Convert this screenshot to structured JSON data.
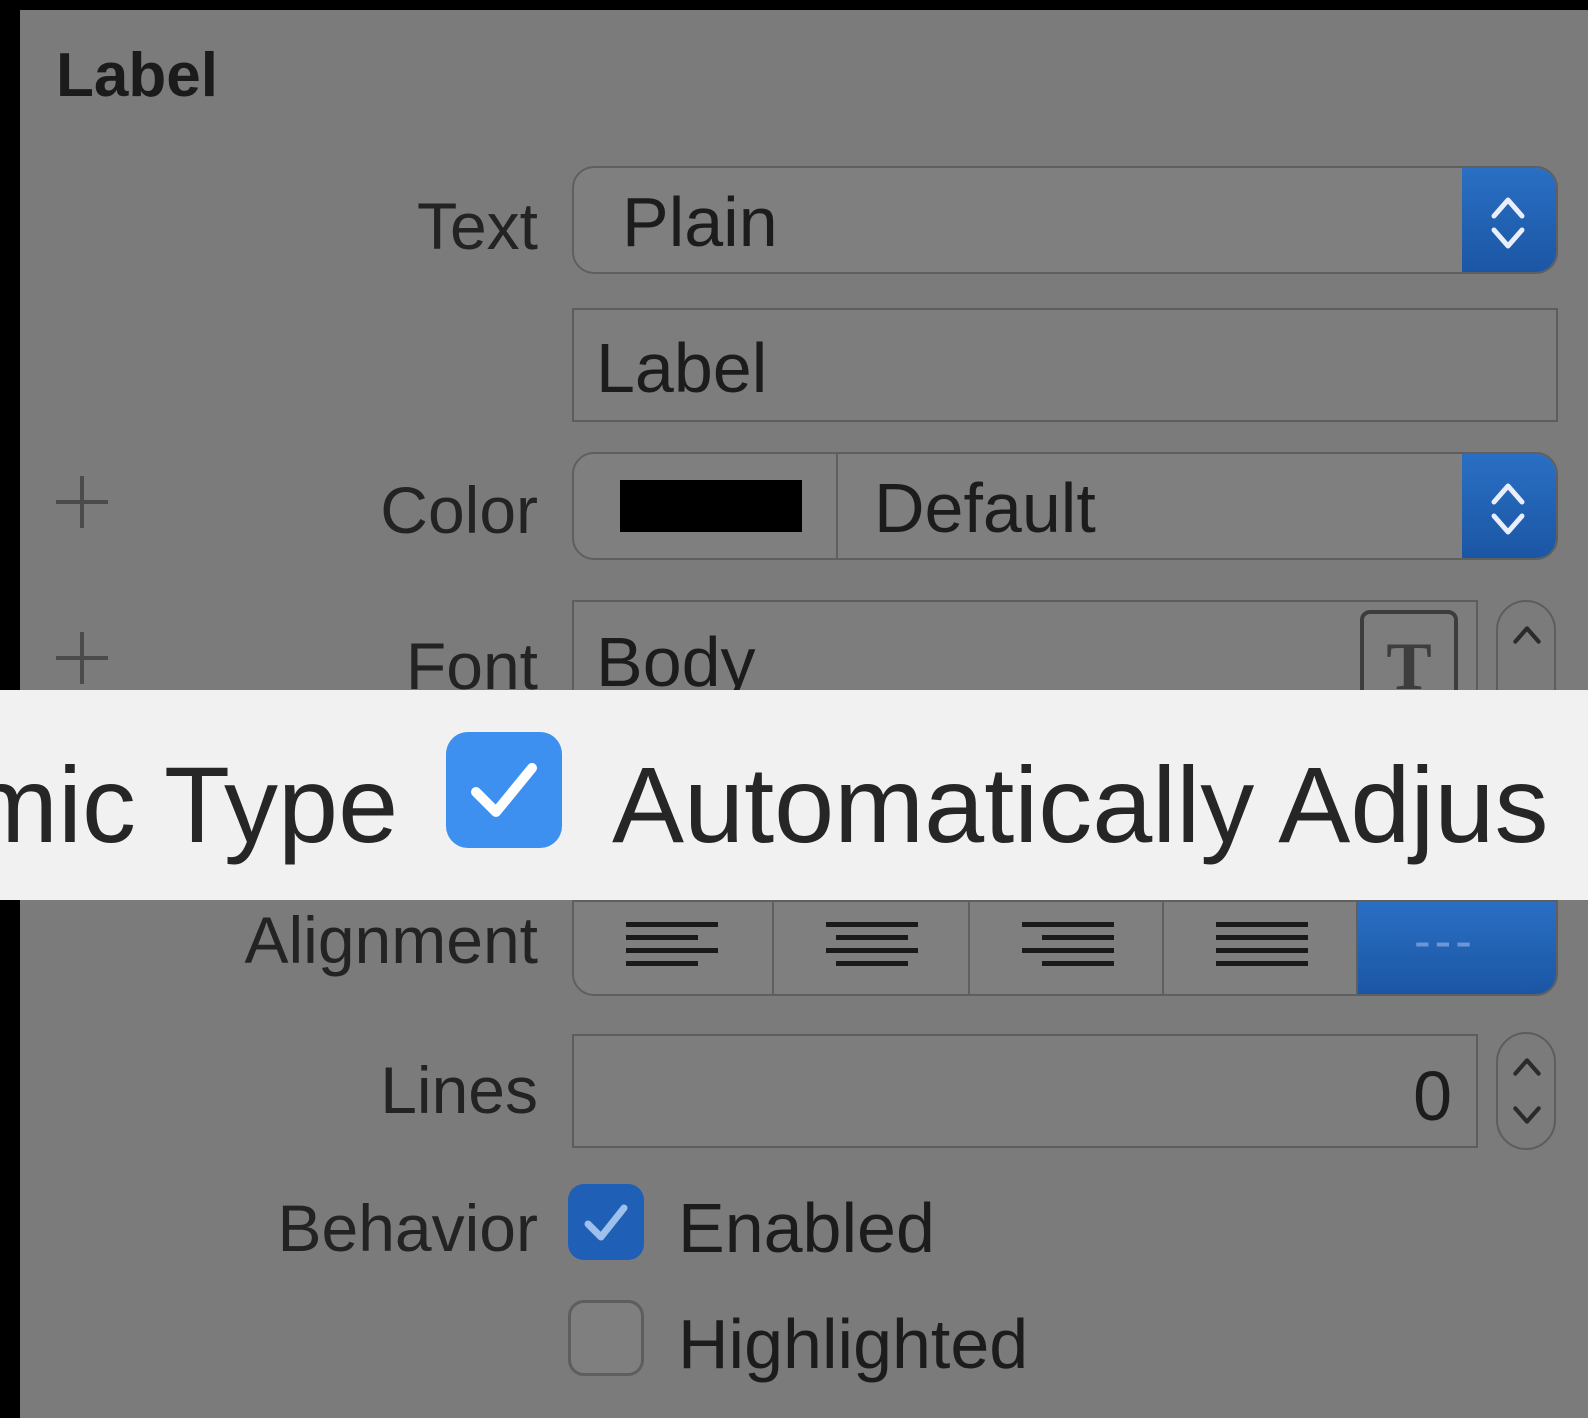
{
  "section": {
    "title": "Label"
  },
  "text_row": {
    "label": "Text",
    "value": "Plain"
  },
  "content_field": {
    "value": "Label"
  },
  "color_row": {
    "label": "Color",
    "value": "Default",
    "swatch_color": "#000000"
  },
  "font_row": {
    "label": "Font",
    "value": "Body"
  },
  "dynamic_type": {
    "left_fragment": "mic Type",
    "checkbox_label": "Automatically Adjus",
    "checked": true
  },
  "alignment_row": {
    "label": "Alignment",
    "options": [
      "left",
      "center",
      "right",
      "justified",
      "natural"
    ],
    "selected": "natural",
    "natural_glyph": "---"
  },
  "lines_row": {
    "label": "Lines",
    "value": "0"
  },
  "behavior_row": {
    "label": "Behavior",
    "enabled": {
      "label": "Enabled",
      "checked": true
    },
    "highlighted": {
      "label": "Highlighted",
      "checked": false
    }
  },
  "colors": {
    "accent": "#1f5fb6",
    "accent_light": "#3d8ff0",
    "panel_bg": "#7b7b7b",
    "overlay_bg": "#f1f1f1"
  }
}
